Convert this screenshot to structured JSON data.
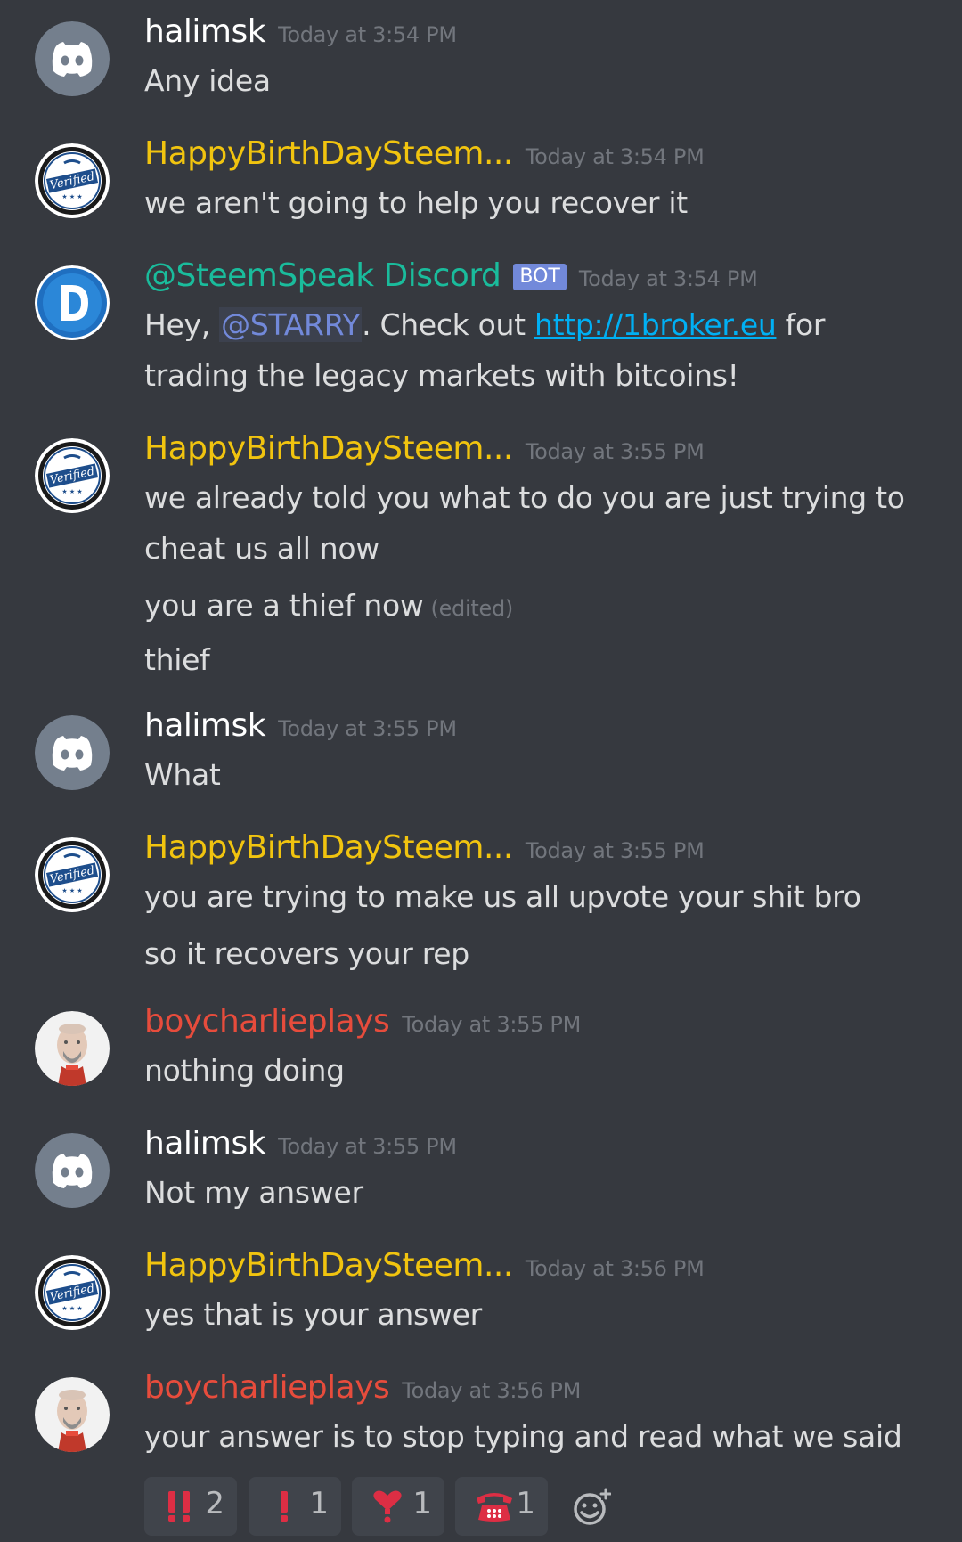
{
  "messages": [
    {
      "username": "halimsk",
      "timestamp": "Today at 3:54 PM",
      "avatar": "discord-default-icon",
      "color": "#ffffff",
      "lines": [
        "Any idea"
      ]
    },
    {
      "username": "HappyBirthDaySteem...",
      "timestamp": "Today at 3:54 PM",
      "avatar": "verified-badge-icon",
      "color": "#f1c40f",
      "lines": [
        "we aren't going to help you recover it"
      ]
    },
    {
      "username": "@SteemSpeak Discord",
      "bot_label": "BOT",
      "timestamp": "Today at 3:54 PM",
      "avatar": "steemspeak-d-icon",
      "color": "#1abc9c",
      "text_before": "Hey, ",
      "mention": "@STARRY",
      "text_middle": ". Check out ",
      "link": "http://1broker.eu",
      "text_after": " for trading the legacy markets with bitcoins!"
    },
    {
      "username": "HappyBirthDaySteem...",
      "timestamp": "Today at 3:55 PM",
      "avatar": "verified-badge-icon",
      "color": "#f1c40f",
      "lines": [
        "we already told you what to do you are just trying to cheat us all now",
        "you are a thief now",
        "thief"
      ],
      "edited_label": "(edited)"
    },
    {
      "username": "halimsk",
      "timestamp": "Today at 3:55 PM",
      "avatar": "discord-default-icon",
      "color": "#ffffff",
      "lines": [
        "What"
      ]
    },
    {
      "username": "HappyBirthDaySteem...",
      "timestamp": "Today at 3:55 PM",
      "avatar": "verified-badge-icon",
      "color": "#f1c40f",
      "lines": [
        "you are trying to make us all upvote your shit bro",
        "so it recovers your rep"
      ]
    },
    {
      "username": "boycharlieplays",
      "timestamp": "Today at 3:55 PM",
      "avatar": "user-photo-avatar",
      "color": "#e74c3c",
      "lines": [
        "nothing doing"
      ]
    },
    {
      "username": "halimsk",
      "timestamp": "Today at 3:55 PM",
      "avatar": "discord-default-icon",
      "color": "#ffffff",
      "lines": [
        "Not my answer"
      ]
    },
    {
      "username": "HappyBirthDaySteem...",
      "timestamp": "Today at 3:56 PM",
      "avatar": "verified-badge-icon",
      "color": "#f1c40f",
      "lines": [
        "yes that is your answer"
      ]
    },
    {
      "username": "boycharlieplays",
      "timestamp": "Today at 3:56 PM",
      "avatar": "user-photo-avatar",
      "color": "#e74c3c",
      "lines": [
        "your answer is to stop typing and read what we said"
      ]
    }
  ],
  "reactions": [
    {
      "emoji": "double-exclamation-icon",
      "count": "2"
    },
    {
      "emoji": "exclamation-icon",
      "count": "1"
    },
    {
      "emoji": "heart-exclamation-icon",
      "count": "1"
    },
    {
      "emoji": "telephone-icon",
      "count": "1"
    }
  ],
  "add_reaction_icon": "add-reaction-icon",
  "colors": {
    "background": "#36393f",
    "text": "#dcddde",
    "timestamp": "#72767d",
    "mention": "#7289da",
    "link": "#00b0f4",
    "reaction_bg": "#40444b"
  }
}
